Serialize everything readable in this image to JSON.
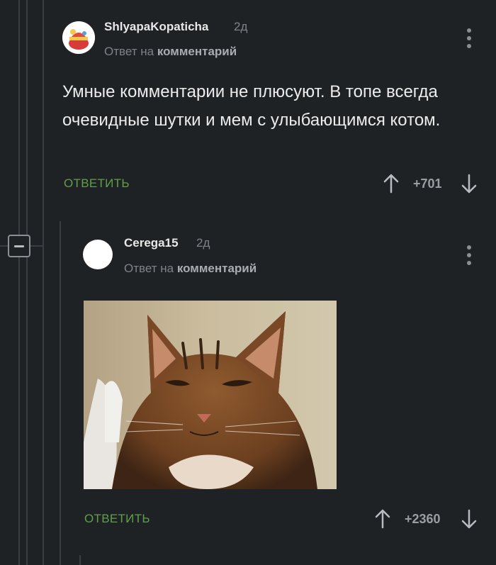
{
  "comments": [
    {
      "username": "ShlyapaKopaticha",
      "time": "2д",
      "reply_prefix": "Ответ на",
      "reply_target": "комментарий",
      "text": "Умные комментарии не плюсуют. В топе всегда очевидные шутки и мем с улыбающимся котом.",
      "reply_label": "ОТВЕТИТЬ",
      "score": "+701"
    },
    {
      "username": "Cerega15",
      "time": "2д",
      "reply_prefix": "Ответ на",
      "reply_target": "комментарий",
      "image_alt": "smiling tabby cat",
      "reply_label": "ОТВЕТИТЬ",
      "score": "+2360"
    }
  ],
  "colors": {
    "background": "#1f2225",
    "reply_green": "#5f9f4a",
    "muted": "#7e8389"
  }
}
